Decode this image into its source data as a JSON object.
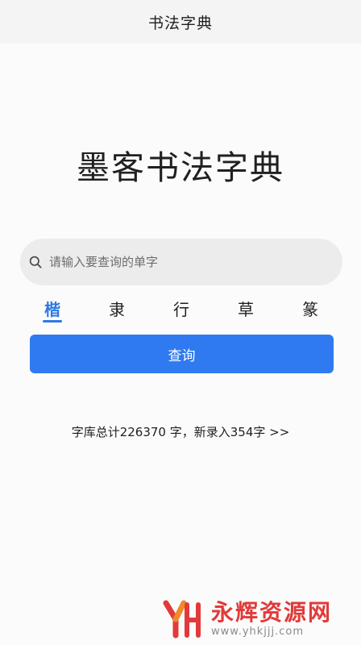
{
  "header": {
    "title": "书法字典"
  },
  "main": {
    "heading": "墨客书法字典",
    "search": {
      "placeholder": "请输入要查询的单字",
      "value": ""
    },
    "tabs": [
      {
        "label": "楷",
        "active": true
      },
      {
        "label": "隶",
        "active": false
      },
      {
        "label": "行",
        "active": false
      },
      {
        "label": "草",
        "active": false
      },
      {
        "label": "篆",
        "active": false
      }
    ],
    "query_button": "查询",
    "stats": "字库总计226370 字，新录入354字 >>"
  },
  "watermark": {
    "title": "永辉资源网",
    "url": "www.yhkjjj.com"
  },
  "colors": {
    "accent": "#2d78e6",
    "button": "#2f7af0",
    "watermark": "#e23a3a"
  },
  "icons": [
    "search-icon"
  ]
}
